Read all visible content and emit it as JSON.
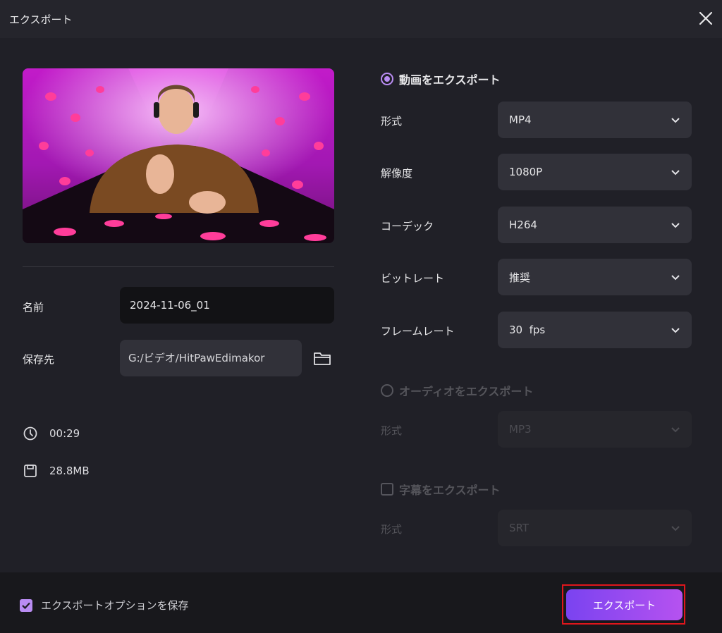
{
  "window": {
    "title": "エクスポート"
  },
  "preview": {
    "description_icon": "video-thumbnail"
  },
  "file": {
    "name_label": "名前",
    "name_value": "2024-11-06_01",
    "save_label": "保存先",
    "save_path": "G:/ビデオ/HitPawEdimakor",
    "duration": "00:29",
    "size": "28.8MB"
  },
  "video_export": {
    "label": "動画をエクスポート",
    "selected": true,
    "rows": [
      {
        "label": "形式",
        "value": "MP4"
      },
      {
        "label": "解像度",
        "value": "1080P"
      },
      {
        "label": "コーデック",
        "value": "H264"
      },
      {
        "label": "ビットレート",
        "value": "推奨"
      },
      {
        "label": "フレームレート",
        "value": "30  fps"
      }
    ]
  },
  "audio_export": {
    "label": "オーディオをエクスポート",
    "selected": false,
    "format_label": "形式",
    "format_value": "MP3"
  },
  "subtitle_export": {
    "label": "字幕をエクスポート",
    "checked": false,
    "format_label": "形式",
    "format_value": "SRT"
  },
  "footer": {
    "save_options_label": "エクスポートオプションを保存",
    "save_options_checked": true,
    "export_button": "エクスポート"
  },
  "colors": {
    "accent": "#b98cf2",
    "button_start": "#7a43f0",
    "button_end": "#b652f0",
    "highlight": "#e0161c"
  }
}
